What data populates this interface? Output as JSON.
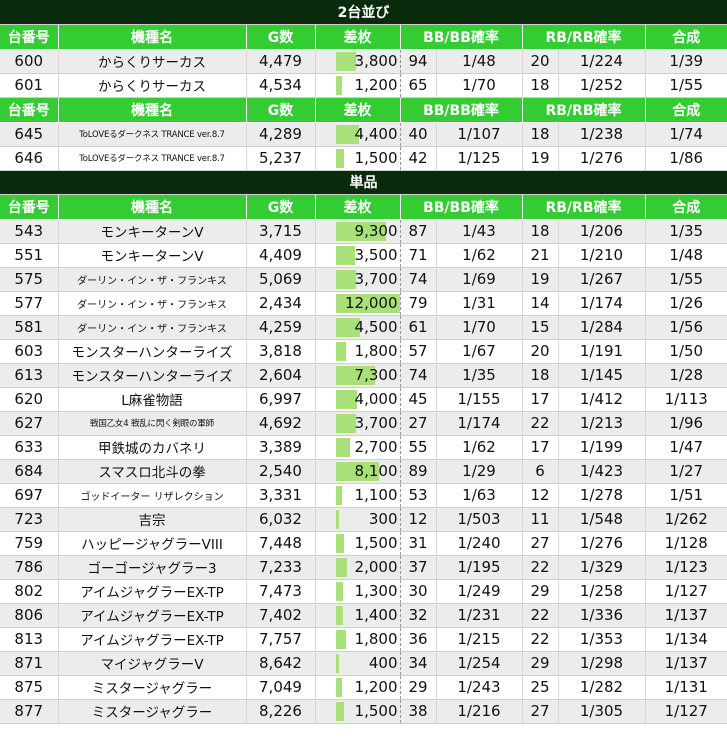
{
  "sections": [
    {
      "title": "2台並び",
      "groups": [
        {
          "headers": [
            "台番号",
            "機種名",
            "G数",
            "差枚",
            "BB/BB確率",
            "RB/RB確率",
            "合成"
          ],
          "rows": [
            {
              "no": "600",
              "name": "からくりサーカス",
              "g": "4,479",
              "diff": "3,800",
              "diff_value": 3800,
              "bb": "94",
              "bbp": "1/48",
              "rb": "20",
              "rbp": "1/224",
              "comb": "1/39",
              "size": "n"
            },
            {
              "no": "601",
              "name": "からくりサーカス",
              "g": "4,534",
              "diff": "1,200",
              "diff_value": 1200,
              "bb": "65",
              "bbp": "1/70",
              "rb": "18",
              "rbp": "1/252",
              "comb": "1/55",
              "size": "n"
            }
          ]
        },
        {
          "headers": [
            "台番号",
            "機種名",
            "G数",
            "差枚",
            "BB/BB確率",
            "RB/RB確率",
            "合成"
          ],
          "rows": [
            {
              "no": "645",
              "name": "ToLOVEるダークネス TRANCE ver.8.7",
              "g": "4,289",
              "diff": "4,400",
              "diff_value": 4400,
              "bb": "40",
              "bbp": "1/107",
              "rb": "18",
              "rbp": "1/238",
              "comb": "1/74",
              "size": "xs"
            },
            {
              "no": "646",
              "name": "ToLOVEるダークネス TRANCE ver.8.7",
              "g": "5,237",
              "diff": "1,500",
              "diff_value": 1500,
              "bb": "42",
              "bbp": "1/125",
              "rb": "19",
              "rbp": "1/276",
              "comb": "1/86",
              "size": "xs"
            }
          ]
        }
      ]
    },
    {
      "title": "単品",
      "groups": [
        {
          "headers": [
            "台番号",
            "機種名",
            "G数",
            "差枚",
            "BB/BB確率",
            "RB/RB確率",
            "合成"
          ],
          "rows": [
            {
              "no": "543",
              "name": "モンキーターンV",
              "g": "3,715",
              "diff": "9,300",
              "diff_value": 9300,
              "bb": "87",
              "bbp": "1/43",
              "rb": "18",
              "rbp": "1/206",
              "comb": "1/35",
              "size": "n"
            },
            {
              "no": "551",
              "name": "モンキーターンV",
              "g": "4,409",
              "diff": "3,500",
              "diff_value": 3500,
              "bb": "71",
              "bbp": "1/62",
              "rb": "21",
              "rbp": "1/210",
              "comb": "1/48",
              "size": "n"
            },
            {
              "no": "575",
              "name": "ダーリン・イン・ザ・フランキス",
              "g": "5,069",
              "diff": "3,700",
              "diff_value": 3700,
              "bb": "74",
              "bbp": "1/69",
              "rb": "19",
              "rbp": "1/267",
              "comb": "1/55",
              "size": "small"
            },
            {
              "no": "577",
              "name": "ダーリン・イン・ザ・フランキス",
              "g": "2,434",
              "diff": "12,000",
              "diff_value": 12000,
              "bb": "79",
              "bbp": "1/31",
              "rb": "14",
              "rbp": "1/174",
              "comb": "1/26",
              "size": "small"
            },
            {
              "no": "581",
              "name": "ダーリン・イン・ザ・フランキス",
              "g": "4,259",
              "diff": "4,500",
              "diff_value": 4500,
              "bb": "61",
              "bbp": "1/70",
              "rb": "15",
              "rbp": "1/284",
              "comb": "1/56",
              "size": "small"
            },
            {
              "no": "603",
              "name": "モンスターハンターライズ",
              "g": "3,818",
              "diff": "1,800",
              "diff_value": 1800,
              "bb": "57",
              "bbp": "1/67",
              "rb": "20",
              "rbp": "1/191",
              "comb": "1/50",
              "size": "n"
            },
            {
              "no": "613",
              "name": "モンスターハンターライズ",
              "g": "2,604",
              "diff": "7,300",
              "diff_value": 7300,
              "bb": "74",
              "bbp": "1/35",
              "rb": "18",
              "rbp": "1/145",
              "comb": "1/28",
              "size": "n"
            },
            {
              "no": "620",
              "name": "L麻雀物語",
              "g": "6,997",
              "diff": "4,000",
              "diff_value": 4000,
              "bb": "45",
              "bbp": "1/155",
              "rb": "17",
              "rbp": "1/412",
              "comb": "1/113",
              "size": "n"
            },
            {
              "no": "627",
              "name": "戦国乙女4 戦乱に閃く剣眼の軍師",
              "g": "4,692",
              "diff": "3,700",
              "diff_value": 3700,
              "bb": "27",
              "bbp": "1/174",
              "rb": "22",
              "rbp": "1/213",
              "comb": "1/96",
              "size": "xs"
            },
            {
              "no": "633",
              "name": "甲鉄城のカバネリ",
              "g": "3,389",
              "diff": "2,700",
              "diff_value": 2700,
              "bb": "55",
              "bbp": "1/62",
              "rb": "17",
              "rbp": "1/199",
              "comb": "1/47",
              "size": "n"
            },
            {
              "no": "684",
              "name": "スマスロ北斗の拳",
              "g": "2,540",
              "diff": "8,100",
              "diff_value": 8100,
              "bb": "89",
              "bbp": "1/29",
              "rb": "6",
              "rbp": "1/423",
              "comb": "1/27",
              "size": "n"
            },
            {
              "no": "697",
              "name": "ゴッドイーター リザレクション",
              "g": "3,331",
              "diff": "1,100",
              "diff_value": 1100,
              "bb": "53",
              "bbp": "1/63",
              "rb": "12",
              "rbp": "1/278",
              "comb": "1/51",
              "size": "small"
            },
            {
              "no": "723",
              "name": "吉宗",
              "g": "6,032",
              "diff": "300",
              "diff_value": 300,
              "bb": "12",
              "bbp": "1/503",
              "rb": "11",
              "rbp": "1/548",
              "comb": "1/262",
              "size": "n"
            },
            {
              "no": "759",
              "name": "ハッピージャグラーVIII",
              "g": "7,448",
              "diff": "1,500",
              "diff_value": 1500,
              "bb": "31",
              "bbp": "1/240",
              "rb": "27",
              "rbp": "1/276",
              "comb": "1/128",
              "size": "n"
            },
            {
              "no": "786",
              "name": "ゴーゴージャグラー3",
              "g": "7,233",
              "diff": "2,000",
              "diff_value": 2000,
              "bb": "37",
              "bbp": "1/195",
              "rb": "22",
              "rbp": "1/329",
              "comb": "1/123",
              "size": "n"
            },
            {
              "no": "802",
              "name": "アイムジャグラーEX-TP",
              "g": "7,473",
              "diff": "1,300",
              "diff_value": 1300,
              "bb": "30",
              "bbp": "1/249",
              "rb": "29",
              "rbp": "1/258",
              "comb": "1/127",
              "size": "n"
            },
            {
              "no": "806",
              "name": "アイムジャグラーEX-TP",
              "g": "7,402",
              "diff": "1,400",
              "diff_value": 1400,
              "bb": "32",
              "bbp": "1/231",
              "rb": "22",
              "rbp": "1/336",
              "comb": "1/137",
              "size": "n"
            },
            {
              "no": "813",
              "name": "アイムジャグラーEX-TP",
              "g": "7,757",
              "diff": "1,800",
              "diff_value": 1800,
              "bb": "36",
              "bbp": "1/215",
              "rb": "22",
              "rbp": "1/353",
              "comb": "1/134",
              "size": "n"
            },
            {
              "no": "871",
              "name": "マイジャグラーV",
              "g": "8,642",
              "diff": "400",
              "diff_value": 400,
              "bb": "34",
              "bbp": "1/254",
              "rb": "29",
              "rbp": "1/298",
              "comb": "1/137",
              "size": "n"
            },
            {
              "no": "875",
              "name": "ミスタージャグラー",
              "g": "7,049",
              "diff": "1,200",
              "diff_value": 1200,
              "bb": "29",
              "bbp": "1/243",
              "rb": "25",
              "rbp": "1/282",
              "comb": "1/131",
              "size": "n"
            },
            {
              "no": "877",
              "name": "ミスタージャグラー",
              "g": "8,226",
              "diff": "1,500",
              "diff_value": 1500,
              "bb": "38",
              "bbp": "1/216",
              "rb": "27",
              "rbp": "1/305",
              "comb": "1/127",
              "size": "n"
            }
          ]
        }
      ]
    }
  ],
  "colors": {
    "band": "#0b2b0d",
    "header": "#33cc33",
    "bar": "#a8e07a",
    "alt_row": "#ececec"
  },
  "diff_scale_max": 12000
}
